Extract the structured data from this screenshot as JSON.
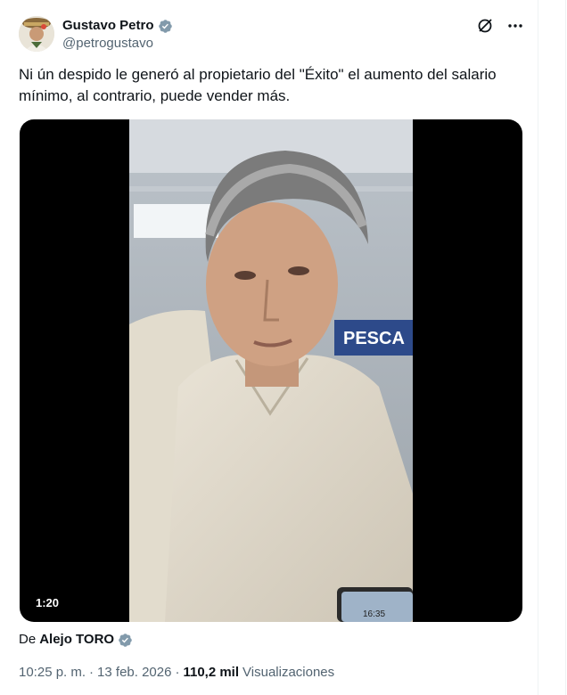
{
  "author": {
    "display_name": "Gustavo Petro",
    "handle": "@petrogustavo",
    "verified": true,
    "verified_color": "#829aab"
  },
  "header_actions": {
    "grok_icon": "grok-slash-circle-icon",
    "more_icon": "more-horizontal-icon",
    "more_label": "···"
  },
  "post": {
    "text": "Ni ún despido le generó al propietario del \"Éxito\" el aumento del salario mínimo, al contrario, puede vender más."
  },
  "media": {
    "type": "video",
    "duration": "1:20",
    "background_sign_text": "PESCA",
    "phone_screen_text": "16:35"
  },
  "attribution": {
    "prefix": "De",
    "name": "Alejo TORO",
    "verified": true
  },
  "meta": {
    "time": "10:25 p. m.",
    "separator": "·",
    "date": "13 feb. 2026",
    "views_count": "110,2 mil",
    "views_label": "Visualizaciones"
  },
  "colors": {
    "text_primary": "#0f1419",
    "text_secondary": "#536471",
    "media_letterbox": "#000000"
  }
}
